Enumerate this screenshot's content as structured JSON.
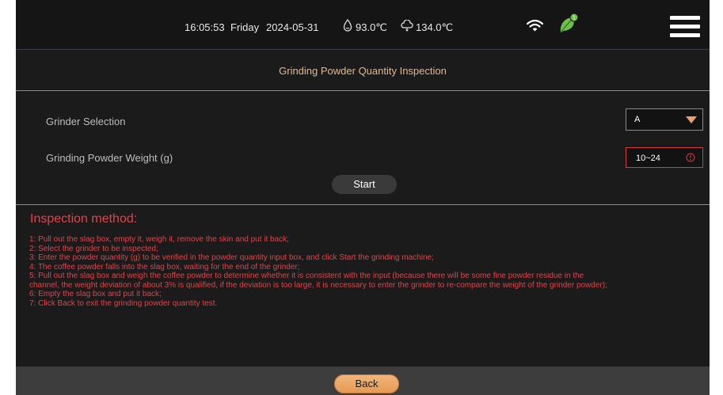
{
  "status": {
    "time": "16:05:53",
    "day": "Friday",
    "date": "2024-05-31",
    "temp_water": "93.0℃",
    "temp_steam": "134.0℃",
    "notification_count": "1",
    "icons": [
      "water-temp-icon",
      "steam-temp-icon",
      "wifi-icon",
      "leaf-icon",
      "menu-icon"
    ]
  },
  "page": {
    "title": "Grinding Powder Quantity Inspection"
  },
  "form": {
    "grinder_label": "Grinder Selection",
    "grinder_value": "A",
    "weight_label": "Grinding Powder Weight (g)",
    "weight_value": "10~24",
    "start_label": "Start"
  },
  "method": {
    "title": "Inspection method:",
    "steps": [
      "1: Pull out the slag box, empty it, weigh it, remove the skin and put it back;",
      " 2: Select the grinder to be inspected;",
      " 3: Enter the powder quantity (g) to be verified in the powder quantity input box, and click Start the grinding machine;",
      " 4: The coffee powder falls into the slag box, waiting for the end of the grinder;",
      " 5: Pull out the slag box and weigh the coffee powder to determine whether it is consistent with the input (because there will be some fine powder residue in the",
      "channel, the weight deviation of about 3% is qualified, if the deviation is too large, it is necessary to enter the grinder to re-compare the weight of the grinder powder);",
      " 6: Empty the slag box and put it back;",
      " 7: Click Back to exit the grinding powder quantity test."
    ]
  },
  "footer": {
    "back_label": "Back"
  },
  "colors": {
    "accent": "#e2b98f",
    "error": "#e0434a",
    "back_button": "#e69952",
    "leaf": "#6cc04a"
  }
}
